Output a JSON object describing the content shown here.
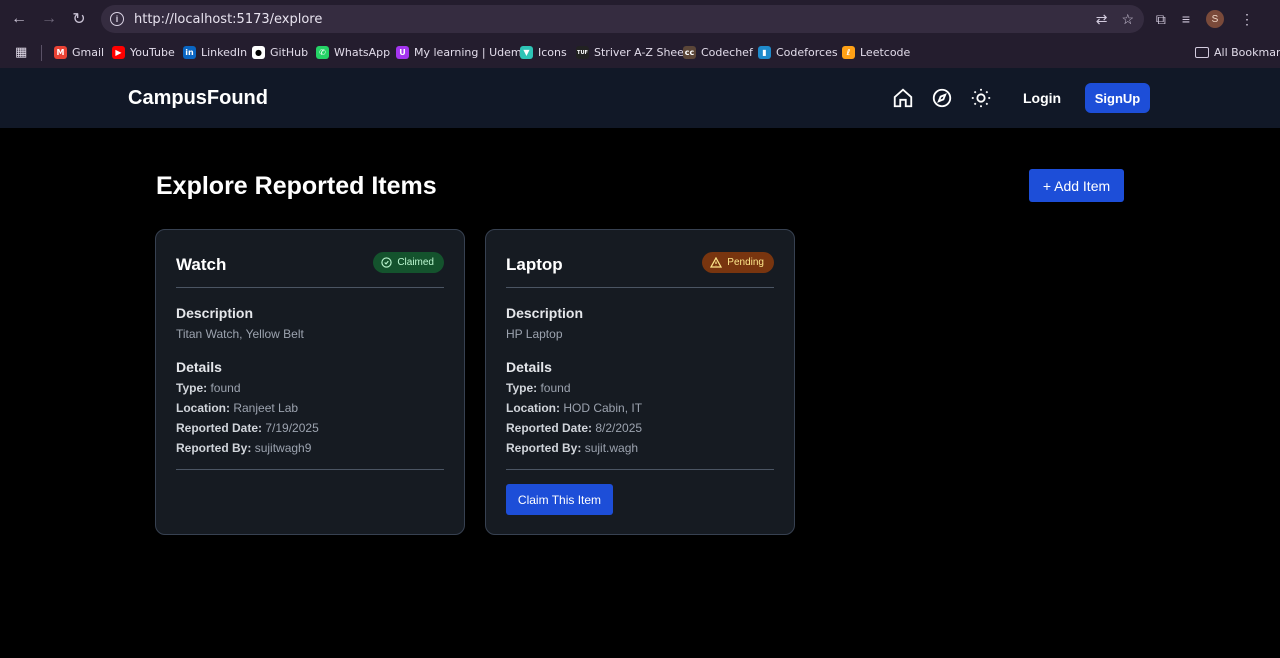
{
  "browser": {
    "url": "http://localhost:5173/explore",
    "profile_initial": "S",
    "bookmarks": [
      {
        "label": "Gmail",
        "icon": "gmail-icon",
        "color": "#ea4335"
      },
      {
        "label": "YouTube",
        "icon": "youtube-icon",
        "color": "#ff0000"
      },
      {
        "label": "LinkedIn",
        "icon": "linkedin-icon",
        "color": "#0a66c2"
      },
      {
        "label": "GitHub",
        "icon": "github-icon",
        "color": "#ffffff"
      },
      {
        "label": "WhatsApp",
        "icon": "whatsapp-icon",
        "color": "#25d366"
      },
      {
        "label": "My learning | Udemy",
        "icon": "udemy-icon",
        "color": "#a435f0"
      },
      {
        "label": "Icons",
        "icon": "icons-icon",
        "color": "#2ec4b6"
      },
      {
        "label": "Striver A-Z Sheet",
        "icon": "striver-icon",
        "color": "#222222"
      },
      {
        "label": "Codechef",
        "icon": "codechef-icon",
        "color": "#5b4638"
      },
      {
        "label": "Codeforces",
        "icon": "codeforces-icon",
        "color": "#1f8acb"
      },
      {
        "label": "Leetcode",
        "icon": "leetcode-icon",
        "color": "#ffa116"
      }
    ],
    "all_bookmarks": "All Bookmarks"
  },
  "app": {
    "brand": "CampusFound",
    "login": "Login",
    "signup": "SignUp"
  },
  "page": {
    "title": "Explore Reported Items",
    "add_item": "+ Add Item"
  },
  "labels": {
    "description": "Description",
    "details": "Details",
    "type": "Type:",
    "location": "Location:",
    "reported_date": "Reported Date:",
    "reported_by": "Reported By:"
  },
  "items": [
    {
      "title": "Watch",
      "status": "Claimed",
      "description": "Titan Watch, Yellow Belt",
      "type": "found",
      "location": "Ranjeet Lab",
      "reported_date": "7/19/2025",
      "reported_by": "sujitwagh9"
    },
    {
      "title": "Laptop",
      "status": "Pending",
      "description": "HP Laptop",
      "type": "found",
      "location": "HOD Cabin, IT",
      "reported_date": "8/2/2025",
      "reported_by": "sujit.wagh",
      "action": "Claim This Item"
    }
  ]
}
